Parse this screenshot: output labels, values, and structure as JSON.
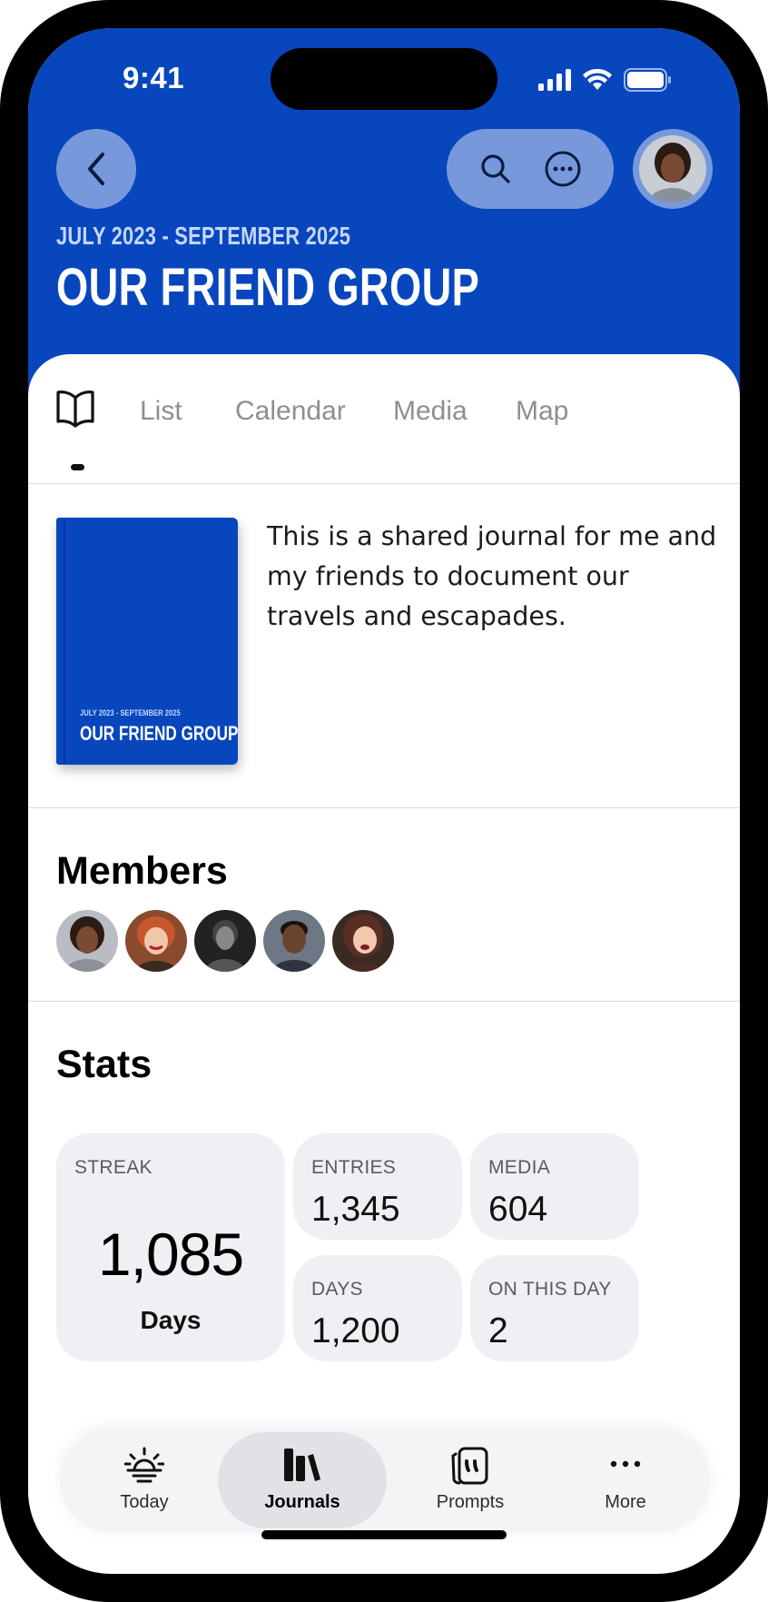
{
  "status_bar": {
    "time": "9:41"
  },
  "header": {
    "date_range": "JULY 2023 - SEPTEMBER 2025",
    "title": "OUR FRIEND GROUP",
    "colors": {
      "header_bg": "#0846BE",
      "date_text": "#C5D6FF"
    }
  },
  "tabs": {
    "items": [
      {
        "label": "List"
      },
      {
        "label": "Calendar"
      },
      {
        "label": "Media"
      },
      {
        "label": "Map"
      }
    ],
    "active_icon": "book-icon"
  },
  "journal": {
    "cover_date": "JULY 2023 - SEPTEMBER 2025",
    "cover_title": "OUR FRIEND GROUP",
    "description": "This is a shared journal for me and my friends to document our travels and escapades."
  },
  "members": {
    "title": "Members",
    "avatars": [
      "member-1",
      "member-2",
      "member-3",
      "member-4",
      "member-5"
    ]
  },
  "stats": {
    "title": "Stats",
    "streak": {
      "label": "STREAK",
      "value": "1,085",
      "unit": "Days"
    },
    "entries": {
      "label": "ENTRIES",
      "value": "1,345"
    },
    "media": {
      "label": "MEDIA",
      "value": "604"
    },
    "days": {
      "label": "DAYS",
      "value": "1,200"
    },
    "on_this_day": {
      "label": "ON THIS DAY",
      "value": "2"
    }
  },
  "tab_bar": {
    "items": [
      {
        "label": "Today",
        "icon": "sunrise-icon"
      },
      {
        "label": "Journals",
        "icon": "journals-icon",
        "active": true
      },
      {
        "label": "Prompts",
        "icon": "prompts-icon"
      },
      {
        "label": "More",
        "icon": "more-icon"
      }
    ]
  }
}
